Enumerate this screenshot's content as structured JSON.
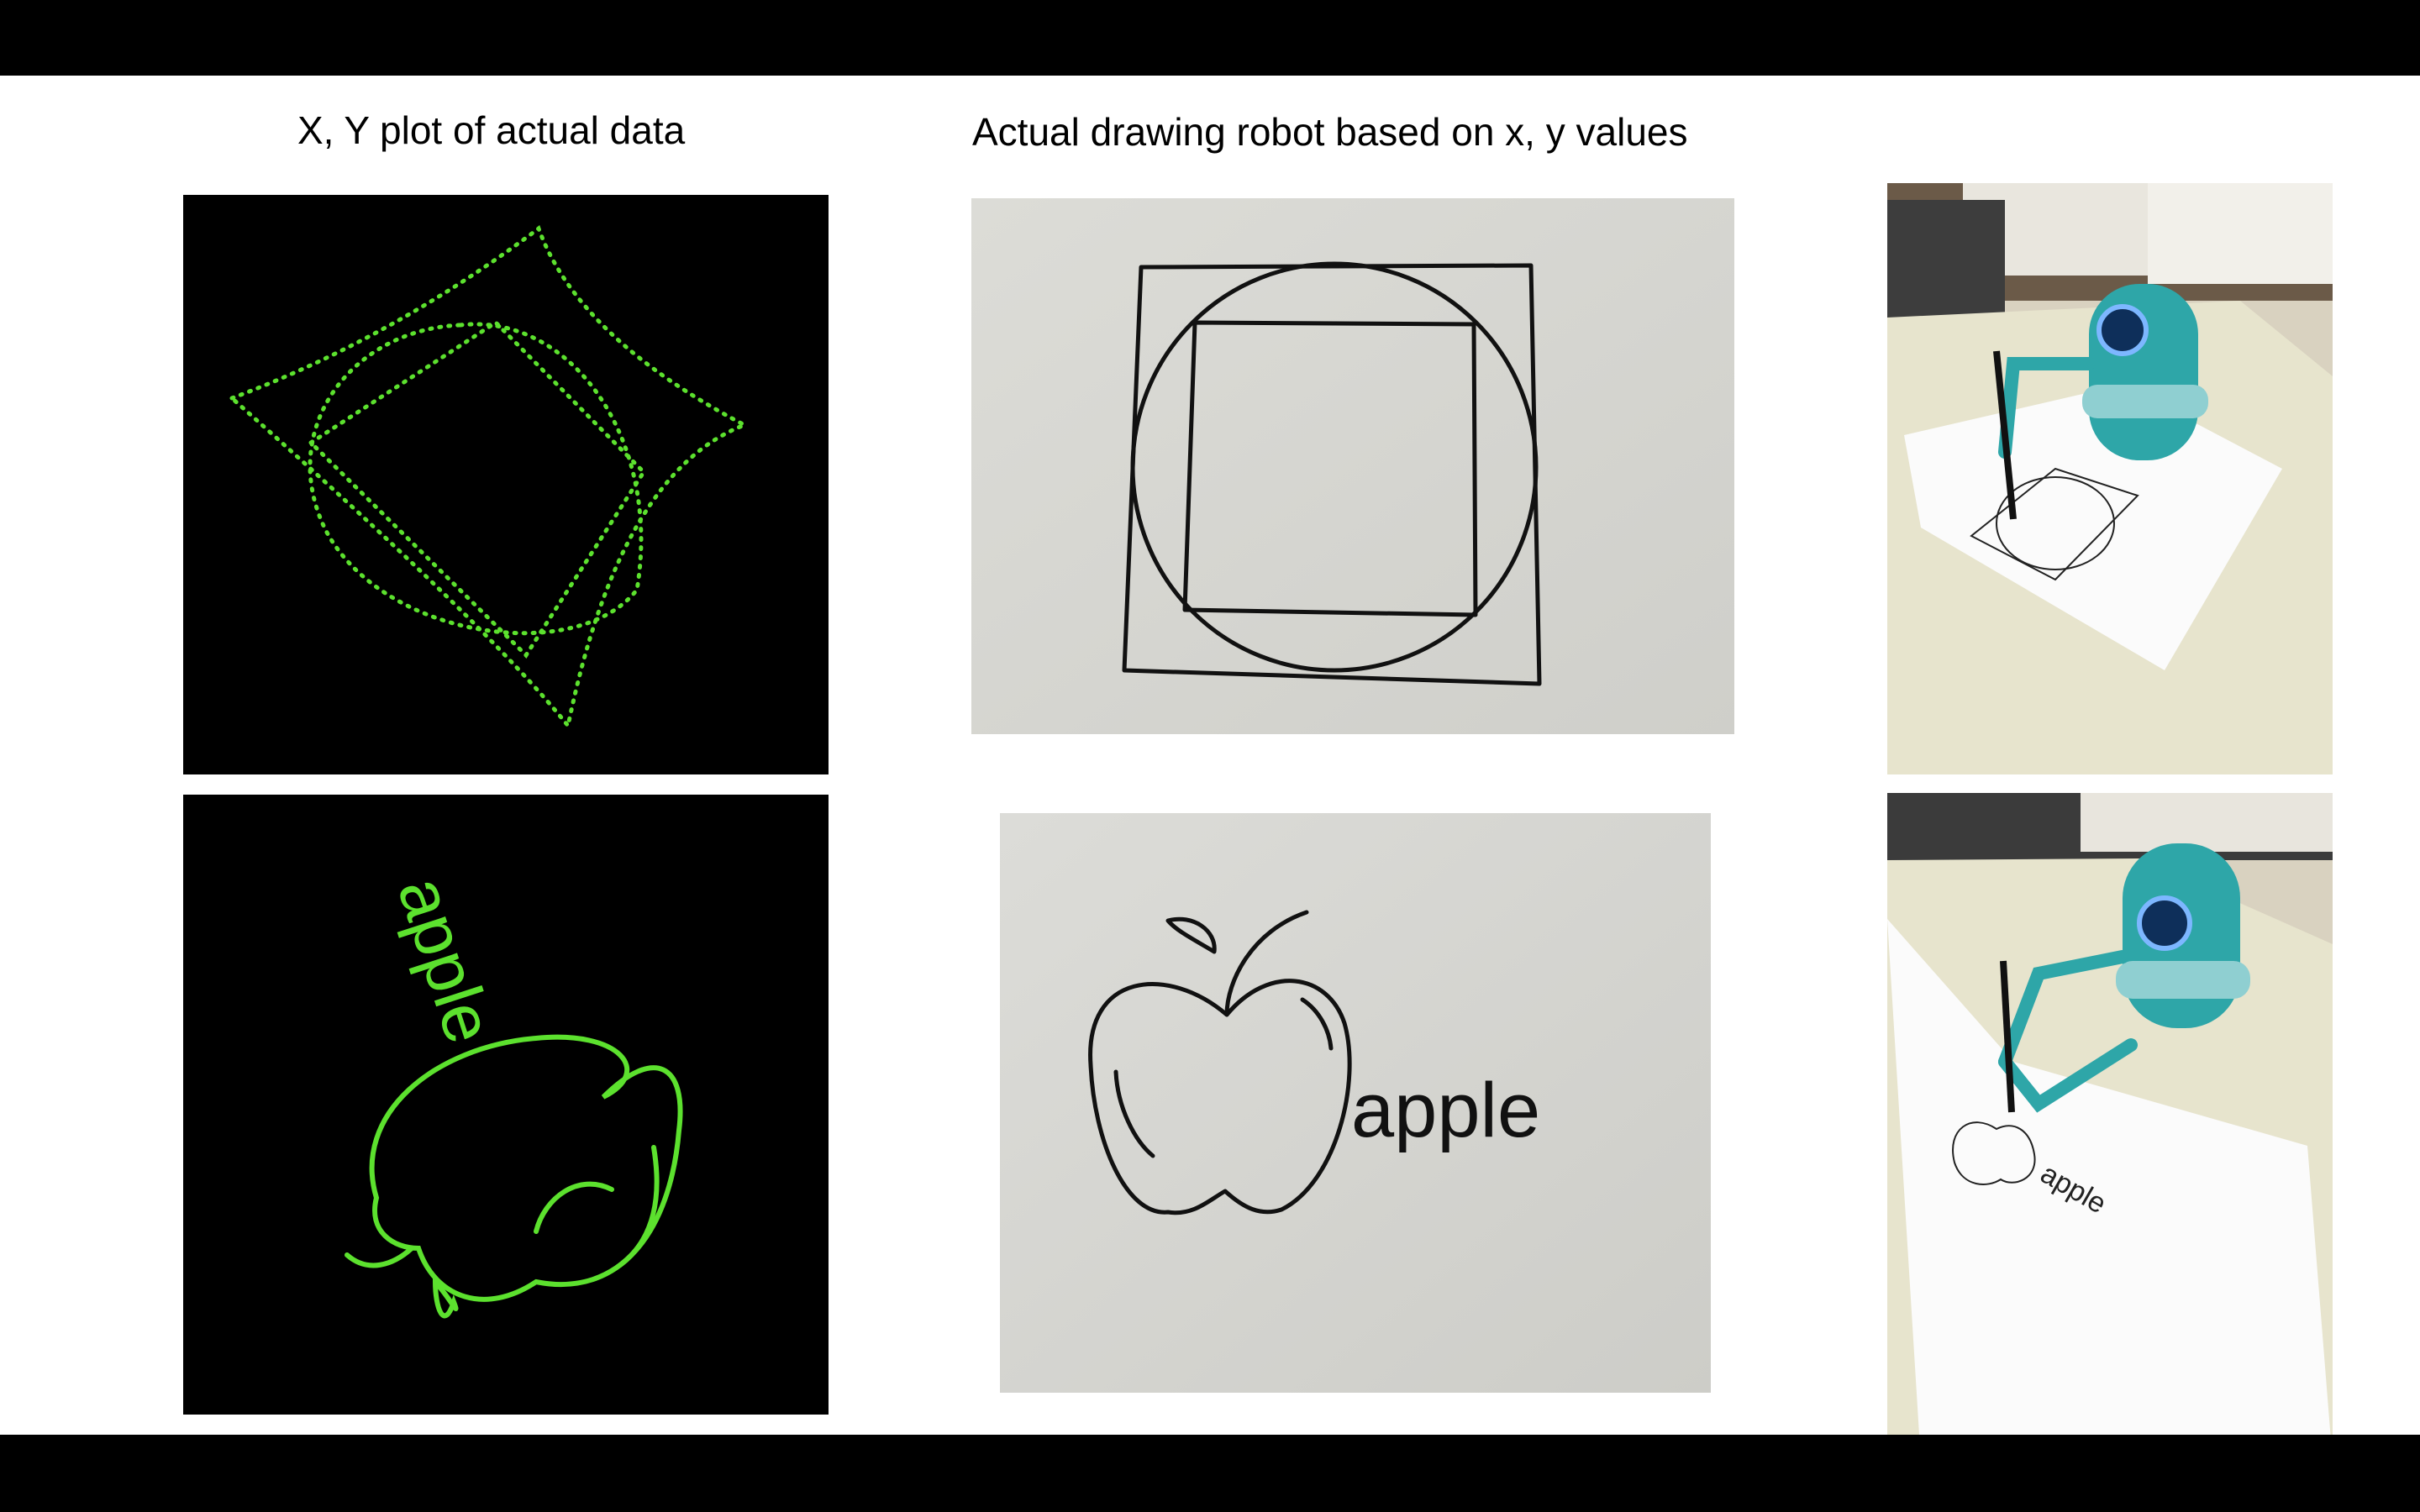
{
  "slide": {
    "heading_left": "X, Y plot of actual data",
    "heading_middle": "Actual drawing robot based on x, y values"
  },
  "plots": {
    "background": "#000000",
    "trace_color": "#5ce12e",
    "apple_plot_label": "apple"
  },
  "drawings": {
    "apple_drawing_label": "apple"
  },
  "photos": {
    "robot_body_color": "#2ea6a8",
    "photo_apple_label": "apple"
  }
}
